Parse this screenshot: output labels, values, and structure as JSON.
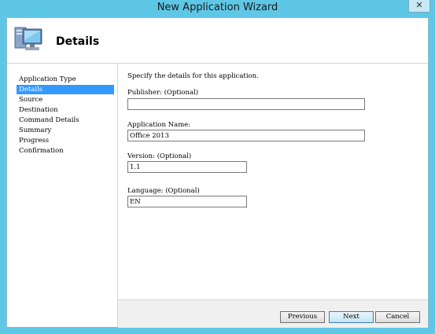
{
  "window": {
    "title": "New Application Wizard",
    "close_label": "✕"
  },
  "header": {
    "title": "Details"
  },
  "nav": {
    "items": [
      {
        "label": "Application Type"
      },
      {
        "label": "Details"
      },
      {
        "label": "Source"
      },
      {
        "label": "Destination"
      },
      {
        "label": "Command Details"
      },
      {
        "label": "Summary"
      },
      {
        "label": "Progress"
      },
      {
        "label": "Confirmation"
      }
    ],
    "active_index": 1
  },
  "form": {
    "instruction": "Specify the details for this application.",
    "publisher": {
      "label": "Publisher: (Optional)",
      "value": ""
    },
    "app_name": {
      "label": "Application Name:",
      "value": "Office 2013"
    },
    "version": {
      "label": "Version: (Optional)",
      "value": "1.1"
    },
    "language": {
      "label": "Language: (Optional)",
      "value": "EN"
    }
  },
  "buttons": {
    "previous": "Previous",
    "next": "Next",
    "cancel": "Cancel"
  },
  "colors": {
    "frame": "#5fc7e6",
    "selection": "#3399ff"
  }
}
